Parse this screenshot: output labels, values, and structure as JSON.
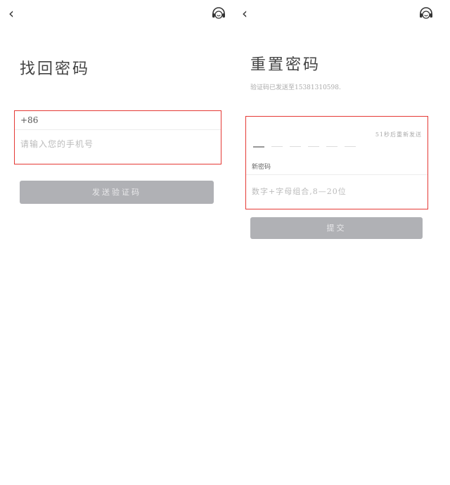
{
  "left_screen": {
    "back_glyph": "‹",
    "title": "找回密码",
    "country_code": "+86",
    "phone_placeholder": "请输入您的手机号",
    "send_code_button": "发送验证码"
  },
  "right_screen": {
    "back_glyph": "‹",
    "title": "重置密码",
    "sent_notice": "验证码已发送至15381310598.",
    "code_digit_count": 6,
    "countdown_text": "51秒后重新发送",
    "new_password_label": "新密码",
    "password_placeholder": "数字+字母组合,8—20位",
    "submit_button": "提交"
  },
  "colors": {
    "highlight_border": "#e53935",
    "disabled_button": "#b0b1b5"
  },
  "icons": {
    "back": "chevron-left-icon",
    "support": "headset-icon"
  }
}
